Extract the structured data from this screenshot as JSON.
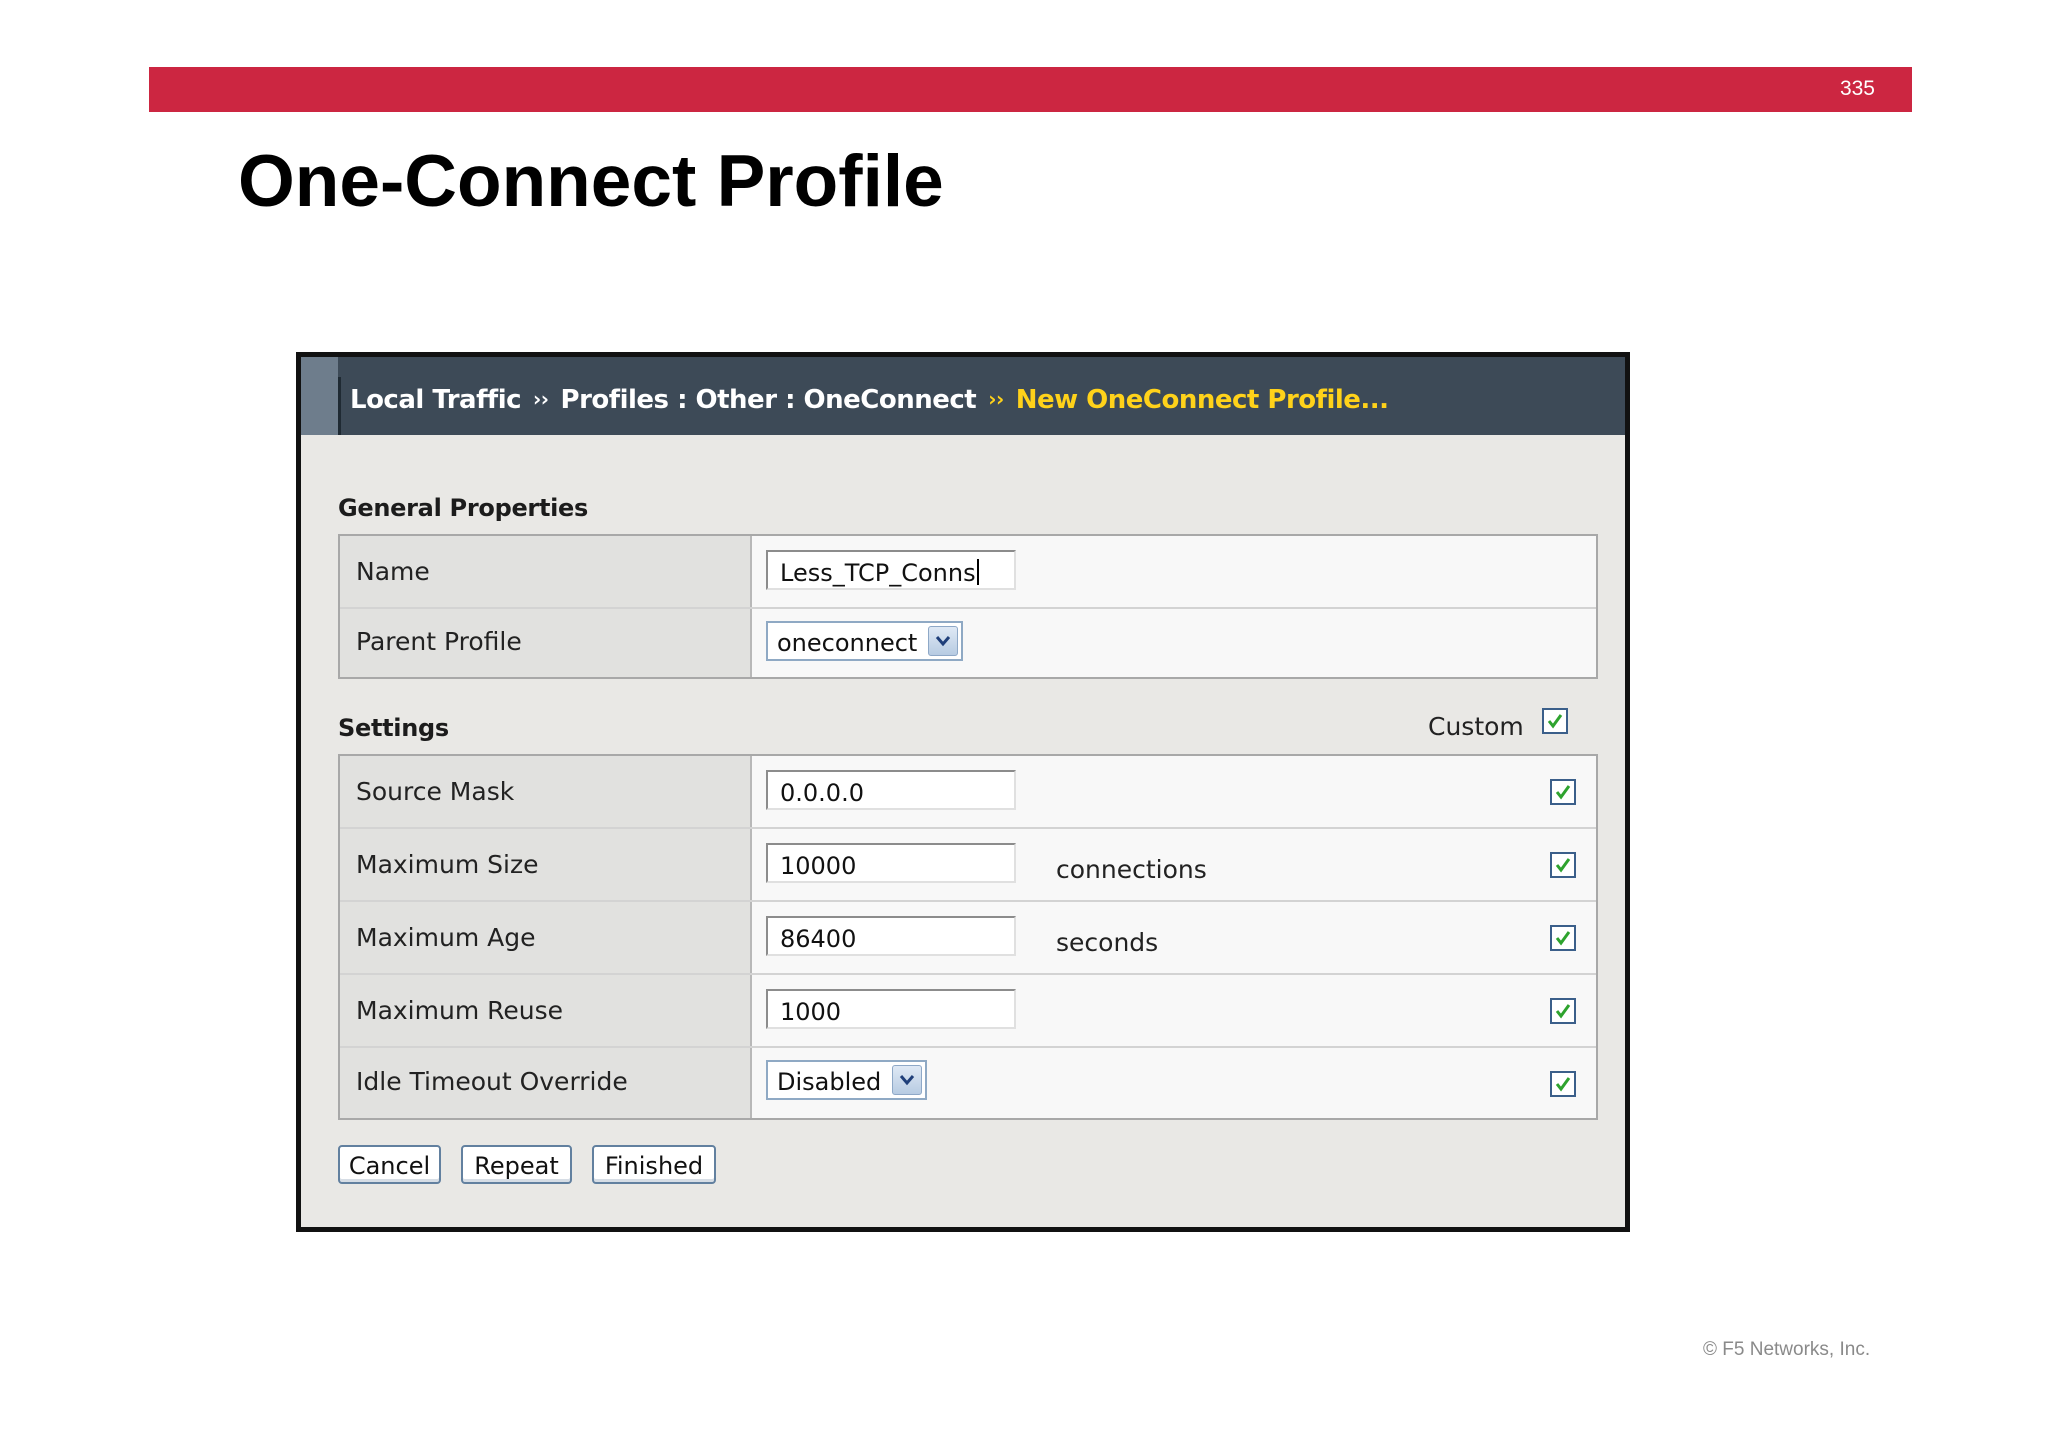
{
  "slide": {
    "page_number": "335",
    "title": "One-Connect Profile",
    "copyright": "© F5 Networks, Inc."
  },
  "breadcrumb": {
    "part1": "Local Traffic",
    "separator": "››",
    "part2": "Profiles : Other : OneConnect",
    "current": "New OneConnect Profile..."
  },
  "general": {
    "title": "General Properties",
    "name_label": "Name",
    "name_value": "Less_TCP_Conns",
    "parent_label": "Parent Profile",
    "parent_value": "oneconnect"
  },
  "settings": {
    "title": "Settings",
    "custom_label": "Custom",
    "source_mask_label": "Source Mask",
    "source_mask_value": "0.0.0.0",
    "max_size_label": "Maximum Size",
    "max_size_value": "10000",
    "max_size_unit": "connections",
    "max_age_label": "Maximum Age",
    "max_age_value": "86400",
    "max_age_unit": "seconds",
    "max_reuse_label": "Maximum Reuse",
    "max_reuse_value": "1000",
    "idle_label": "Idle Timeout Override",
    "idle_value": "Disabled"
  },
  "buttons": {
    "cancel": "Cancel",
    "repeat": "Repeat",
    "finished": "Finished"
  },
  "colors": {
    "slide_accent": "#cc2641",
    "header_bar": "#3d4a57",
    "breadcrumb_current": "#ffd21a",
    "checkmark": "#2ea32e"
  },
  "icons": {
    "checkbox": "checkmark-icon",
    "dropdown": "chevron-down-icon"
  }
}
